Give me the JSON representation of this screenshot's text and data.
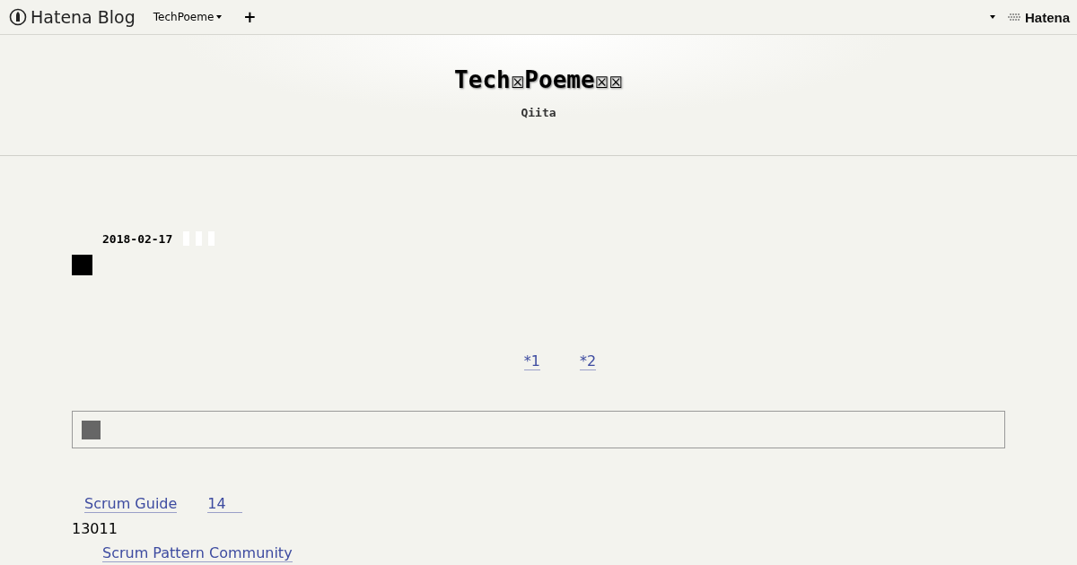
{
  "topbar": {
    "logo": "Hatena Blog",
    "blog_menu": "TechPoeme",
    "add": "+",
    "brand": "Hatena"
  },
  "header": {
    "title": "Tech☒Poeme☒☒",
    "description": "Qiita"
  },
  "entry": {
    "date": "2018-02-17",
    "footnote_refs": [
      "*1",
      "*2"
    ],
    "links": [
      {
        "text": "Scrum Guide"
      },
      {
        "text": "14"
      }
    ],
    "count": "13011",
    "sublink": "Scrum Pattern Community"
  }
}
